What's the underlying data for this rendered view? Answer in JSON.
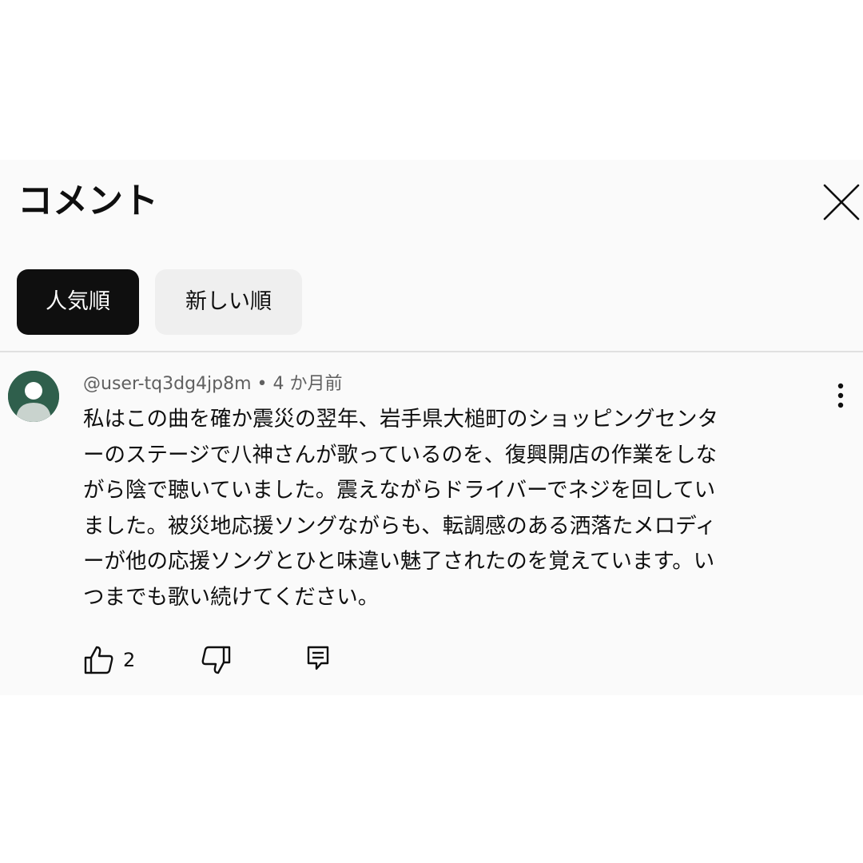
{
  "header": {
    "title": "コメント",
    "close_icon": "close-icon"
  },
  "sort_chips": [
    {
      "label": "人気順",
      "selected": true
    },
    {
      "label": "新しい順",
      "selected": false
    }
  ],
  "comment": {
    "author": "@user-tq3dg4jp8m",
    "separator": " • ",
    "time": "4 か月前",
    "text_lines": [
      "私はこの曲を確か震災の翌年、岩手県大槌町のショッピングセンタ",
      "ーのステージで八神さんが歌っているのを、復興開店の作業をしな",
      "がら陰で聴いていました。震えながらドライバーでネジを回してい",
      "ました。被災地応援ソングながらも、転調感のある洒落たメロディ",
      "ーが他の応援ソングとひと味違い魅了されたのを覚えています。い",
      "つまでも歌い続けてください。"
    ],
    "like_count": "2",
    "icons": {
      "avatar": "default-avatar-icon",
      "more": "more-vert-icon",
      "like": "thumbs-up-icon",
      "dislike": "thumbs-down-icon",
      "reply": "reply-comment-icon"
    }
  },
  "colors": {
    "panel_bg": "#fafafa",
    "text_primary": "#0f0f0f",
    "text_secondary": "#606060",
    "chip_active_bg": "#0f0f0f",
    "chip_inactive_bg": "#efefef",
    "avatar_bg": "#2f5f4c"
  }
}
